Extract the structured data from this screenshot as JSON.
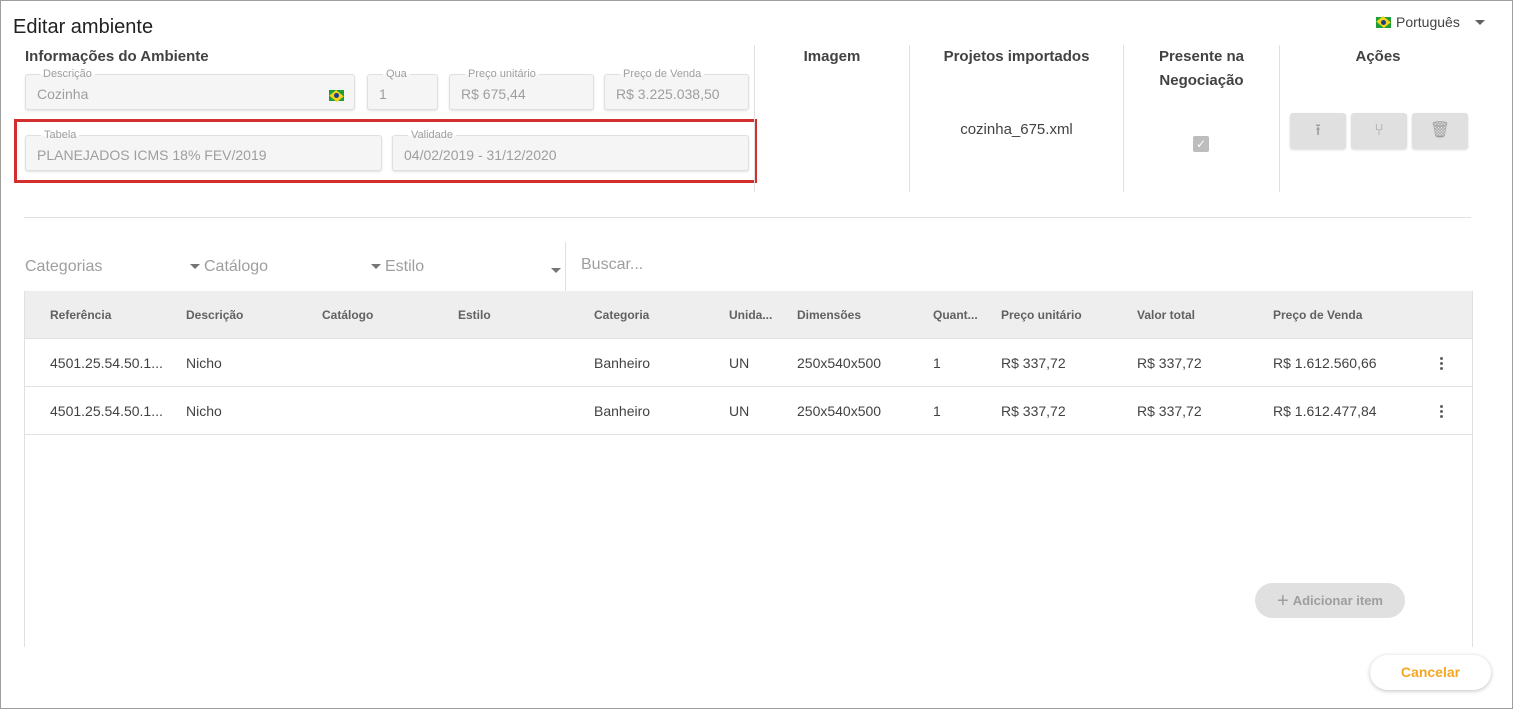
{
  "window": {
    "title": "Editar ambiente"
  },
  "language": {
    "label": "Português"
  },
  "info": {
    "section_title": "Informações do Ambiente",
    "descricao": {
      "label": "Descrição",
      "value": "Cozinha"
    },
    "quantidade": {
      "label": "Qua",
      "value": "1"
    },
    "preco_unitario": {
      "label": "Preço unitário",
      "value": "R$ 675,44"
    },
    "preco_venda": {
      "label": "Preço de Venda",
      "value": "R$ 3.225.038,50"
    },
    "tabela": {
      "label": "Tabela",
      "value": "PLANEJADOS ICMS 18% FEV/2019"
    },
    "validade": {
      "label": "Validade",
      "value": "04/02/2019 - 31/12/2020"
    }
  },
  "columns": {
    "imagem": "Imagem",
    "projetos": "Projetos importados",
    "presente_line1": "Presente na",
    "presente_line2": "Negociação",
    "acoes": "Ações"
  },
  "projeto_file": "cozinha_675.xml",
  "presente_checked": true,
  "actions": [
    {
      "icon": "upload-icon",
      "glyph": "⭱"
    },
    {
      "icon": "fork-icon",
      "glyph": "⑂"
    },
    {
      "icon": "trash-icon",
      "glyph": "🗑"
    }
  ],
  "filters": {
    "categorias": "Categorias",
    "catalogo": "Catálogo",
    "estilo": "Estilo",
    "search_placeholder": "Buscar..."
  },
  "table": {
    "headers": [
      "Referência",
      "Descrição",
      "Catálogo",
      "Estilo",
      "Categoria",
      "Unida...",
      "Dimensões",
      "Quant...",
      "Preço unitário",
      "Valor total",
      "Preço de Venda"
    ],
    "rows": [
      [
        "4501.25.54.50.1...",
        "Nicho",
        "",
        "",
        "Banheiro",
        "UN",
        "250x540x500",
        "1",
        "R$ 337,72",
        "R$ 337,72",
        "R$ 1.612.560,66"
      ],
      [
        "4501.25.54.50.1...",
        "Nicho",
        "",
        "",
        "Banheiro",
        "UN",
        "250x540x500",
        "1",
        "R$ 337,72",
        "R$ 337,72",
        "R$ 1.612.477,84"
      ]
    ]
  },
  "buttons": {
    "add_item": "Adicionar item",
    "cancel": "Cancelar"
  },
  "colors": {
    "highlight": "#d32f2f",
    "accent": "#f5a623"
  }
}
